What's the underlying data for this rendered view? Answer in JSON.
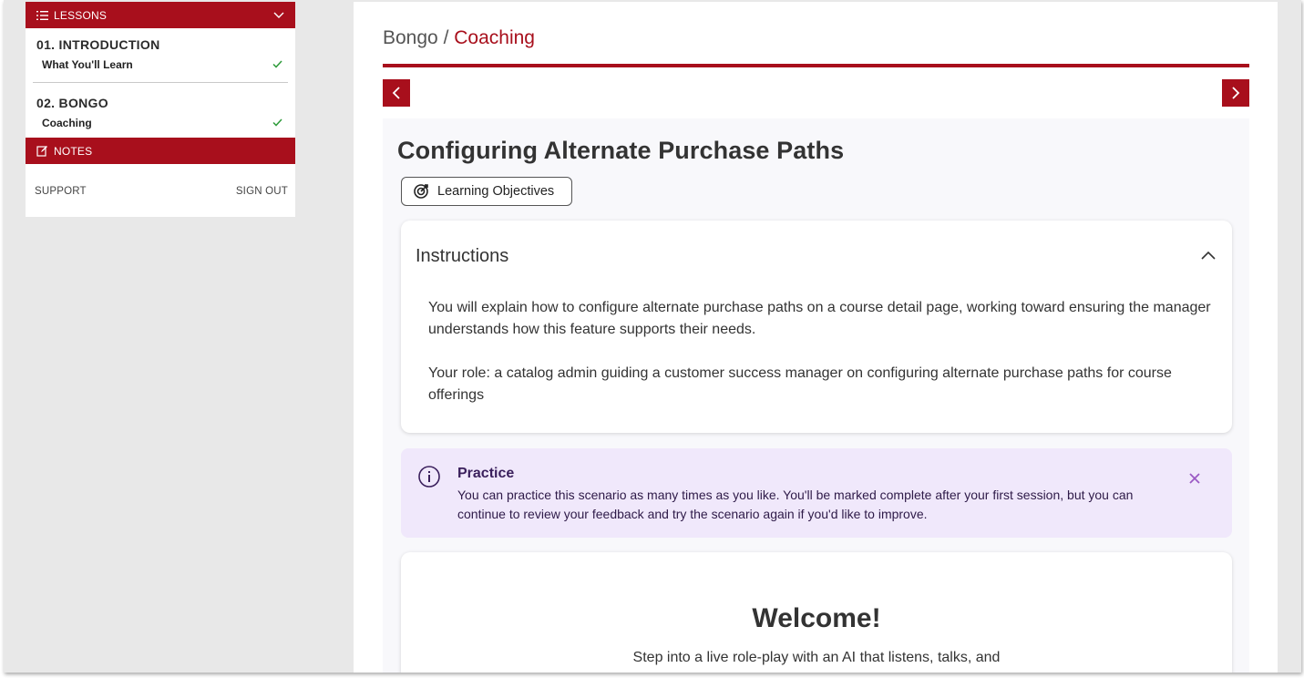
{
  "sidebar": {
    "lessons_label": "LESSONS",
    "sections": [
      {
        "title": "01. INTRODUCTION",
        "item": "What You'll Learn"
      },
      {
        "title": "02. BONGO",
        "item": "Coaching"
      }
    ],
    "notes_label": "NOTES",
    "support_label": "SUPPORT",
    "signout_label": "SIGN OUT"
  },
  "breadcrumb": {
    "parent": "Bongo",
    "separator": " / ",
    "current": "Coaching"
  },
  "content": {
    "title": "Configuring Alternate Purchase Paths",
    "objectives_label": "Learning Objectives",
    "instructions": {
      "title": "Instructions",
      "p1": "You will explain how to configure alternate purchase paths on a course detail page, working toward ensuring the manager understands how this feature supports their needs.",
      "p2": "Your role: a catalog admin guiding a customer success manager on configuring alternate purchase paths for course offerings"
    },
    "practice": {
      "title": "Practice",
      "text": "You can practice this scenario as many times as you like. You'll be marked complete after your first session, but you can continue to review your feedback and try the scenario again if you'd like to improve."
    },
    "welcome": {
      "title": "Welcome!",
      "subtitle": "Step into a live role-play with an AI that listens, talks, and"
    }
  },
  "colors": {
    "brand": "#a80f1c",
    "practice_bg": "#f0e8fb",
    "check": "#2e9b3a"
  }
}
